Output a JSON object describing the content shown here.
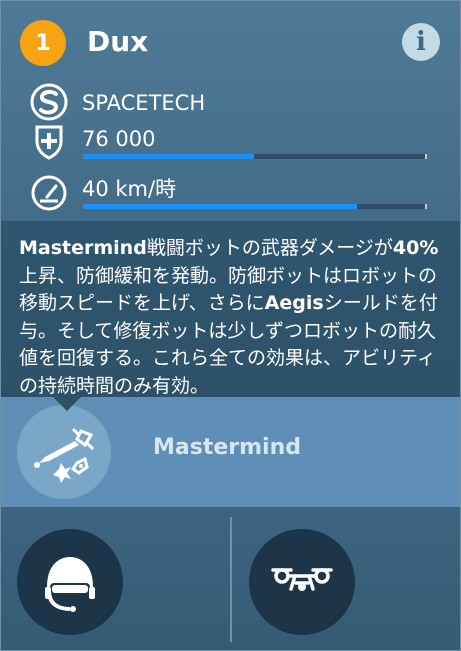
{
  "header": {
    "level": "1",
    "name": "Dux",
    "info_icon": "info-icon"
  },
  "stats": {
    "manufacturer": {
      "icon": "spacetech-logo-icon",
      "label": "SPACETECH"
    },
    "durability": {
      "icon": "shield-plus-icon",
      "label": "76 000",
      "bar_fraction": 0.5
    },
    "speed": {
      "icon": "speedometer-icon",
      "label": "40 km/時",
      "bar_fraction": 0.8
    }
  },
  "description": {
    "parts": [
      {
        "text": "Mastermind",
        "bold": true
      },
      {
        "text": "戦闘ボットの武器ダメージが",
        "bold": false
      },
      {
        "text": "40%",
        "bold": true
      },
      {
        "text": "上昇、防御緩和を発動。防御ボットはロボットの移動スピードを上げ、さらに",
        "bold": false
      },
      {
        "text": "Aegis",
        "bold": true
      },
      {
        "text": "シールドを付与。そして修復ボットは少しずつロボットの耐久値を回復する。これら全ての効果は、アビリティの持続時間のみ有効。",
        "bold": false
      }
    ]
  },
  "ability": {
    "icon": "drone-tools-icon",
    "label": "Mastermind"
  },
  "slots": [
    {
      "icon": "pilot-helmet-icon"
    },
    {
      "icon": "drone-icon"
    }
  ],
  "colors": {
    "level_badge": "#f7a313",
    "bar_fill": "#1b90f5",
    "ability_row": "#5f8fb6"
  }
}
